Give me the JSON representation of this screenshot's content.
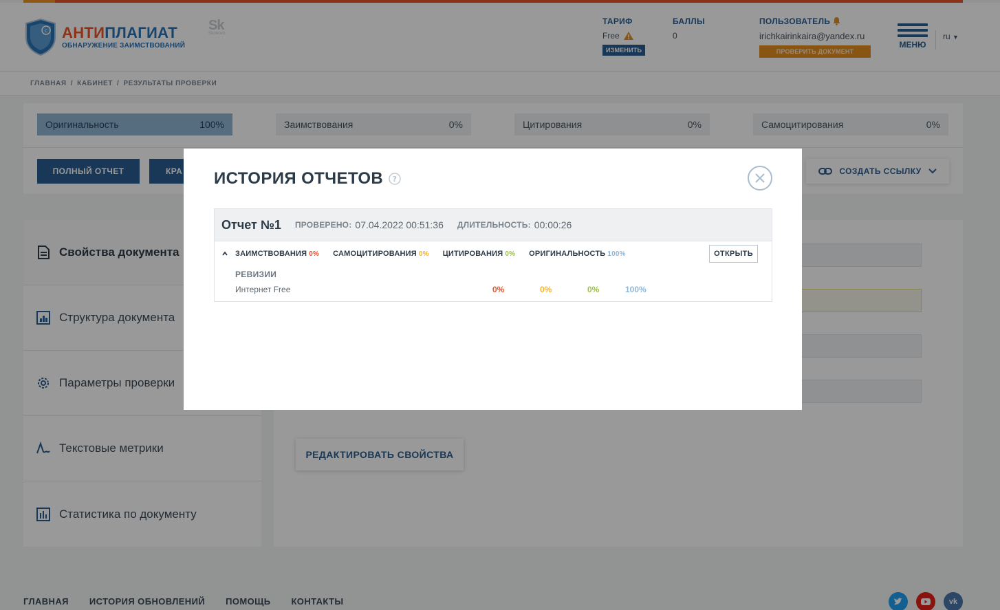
{
  "header": {
    "brand_part1": "АНТИ",
    "brand_part2": "ПЛАГИАТ",
    "brand_sub": "ОБНАРУЖЕНИЕ ЗАИМСТВОВАНИЙ",
    "partner_logo": "Sk",
    "partner_sub": "Skolkovo",
    "tariff_label": "ТАРИФ",
    "tariff_value": "Free",
    "tariff_change": "ИЗМЕНИТЬ",
    "points_label": "БАЛЛЫ",
    "points_value": "0",
    "user_label": "ПОЛЬЗОВАТЕЛЬ",
    "user_email": "irichkairinkaira@yandex.ru",
    "check_document": "ПРОВЕРИТЬ ДОКУМЕНТ",
    "menu_label": "МЕНЮ",
    "language": "ru"
  },
  "breadcrumb": [
    "ГЛАВНАЯ",
    "/",
    "КАБИНЕТ",
    "/",
    "РЕЗУЛЬТАТЫ ПРОВЕРКИ"
  ],
  "metrics": [
    {
      "label": "Оригинальность",
      "value": "100%"
    },
    {
      "label": "Заимствования",
      "value": "0%"
    },
    {
      "label": "Цитирования",
      "value": "0%"
    },
    {
      "label": "Самоцитирования",
      "value": "0%"
    }
  ],
  "actions": {
    "full_report": "ПОЛНЫЙ ОТЧЕТ",
    "short_report": "КРА",
    "create_link": "СОЗДАТЬ ССЫЛКУ"
  },
  "sidebar": [
    {
      "label": "Свойства документа"
    },
    {
      "label": "Структура документа"
    },
    {
      "label": "Параметры проверки"
    },
    {
      "label": "Текстовые метрики"
    },
    {
      "label": "Статистика по документу"
    }
  ],
  "main": {
    "edit_properties": "РЕДАКТИРОВАТЬ СВОЙСТВА"
  },
  "footer": {
    "links": [
      "ГЛАВНАЯ",
      "ИСТОРИЯ ОБНОВЛЕНИЙ",
      "ПОМОЩЬ",
      "КОНТАКТЫ"
    ]
  },
  "modal": {
    "title": "ИСТОРИЯ ОТЧЕТОВ",
    "report": {
      "name": "Отчет №1",
      "checked_label": "ПРОВЕРЕНО:",
      "checked_value": "07.04.2022 00:51:36",
      "duration_label": "ДЛИТЕЛЬНОСТЬ:",
      "duration_value": "00:00:26",
      "borrowings_label": "ЗАИМСТВОВАНИЯ",
      "borrowings_value": "0%",
      "self_citations_label": "САМОЦИТИРОВАНИЯ",
      "self_citations_value": "0%",
      "citations_label": "ЦИТИРОВАНИЯ",
      "citations_value": "0%",
      "originality_label": "ОРИГИНАЛЬНОСТЬ",
      "originality_value": "100%",
      "open_button": "ОТКРЫТЬ",
      "revisions_title": "РЕВИЗИИ",
      "revision": {
        "name": "Интернет Free",
        "borrowings": "0%",
        "self_citations": "0%",
        "citations": "0%",
        "originality": "100%"
      }
    }
  },
  "colors": {
    "accent_blue": "#2a5e91",
    "brand_orange": "#e9542b",
    "borrowings": "#e9542b",
    "self_citations": "#f2b233",
    "citations": "#9bc23f",
    "originality": "#8fb6d6"
  }
}
